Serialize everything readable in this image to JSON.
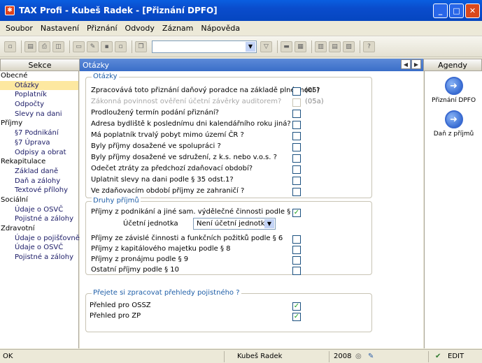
{
  "titlebar": {
    "app_name": "TAX Profi - Kubeš Radek - [Přiznání DPFO]"
  },
  "menu": [
    "Soubor",
    "Nastavení",
    "Přiznání",
    "Odvody",
    "Záznam",
    "Nápověda"
  ],
  "panels": {
    "left_header": "Sekce",
    "center_header": "Otázky",
    "right_header": "Agendy"
  },
  "tree": [
    {
      "label": "Obecné",
      "level": 0
    },
    {
      "label": "Otázky",
      "level": 1,
      "selected": true
    },
    {
      "label": "Poplatník",
      "level": 1
    },
    {
      "label": "Odpočty",
      "level": 1
    },
    {
      "label": "Slevy na dani",
      "level": 1
    },
    {
      "label": "Příjmy",
      "level": 0
    },
    {
      "label": "§7 Podnikání",
      "level": 1
    },
    {
      "label": "§7 Úprava",
      "level": 1
    },
    {
      "label": "Odpisy a obrat",
      "level": 1
    },
    {
      "label": "Rekapitulace",
      "level": 0
    },
    {
      "label": "Základ daně",
      "level": 1
    },
    {
      "label": "Daň a zálohy",
      "level": 1
    },
    {
      "label": "Textové přílohy",
      "level": 1
    },
    {
      "label": "Sociální",
      "level": 0
    },
    {
      "label": "Údaje o OSVČ",
      "level": 1
    },
    {
      "label": "Pojistné a zálohy",
      "level": 1
    },
    {
      "label": "Zdravotní",
      "level": 0
    },
    {
      "label": "Údaje o pojišťovně",
      "level": 1
    },
    {
      "label": "Údaje o OSVČ",
      "level": 1
    },
    {
      "label": "Pojistné a zálohy",
      "level": 1
    }
  ],
  "groups": {
    "otazky": "Otázky",
    "druhy": "Druhy příjmů",
    "prehledy": "Přejete si zpracovat přehledy pojistného ?"
  },
  "questions": [
    {
      "text": "Zpracovává toto přiznání daňový poradce na základě plné moci ?",
      "checked": false,
      "code": "(05)"
    },
    {
      "text": "Zákonná povinnost ověření účetní závěrky auditorem?",
      "checked": false,
      "code": "(05a)",
      "disabled": true
    },
    {
      "text": "Prodloužený termín podání přiznání?",
      "checked": false
    },
    {
      "text": "Adresa bydliště k poslednímu dni kalendářního roku jiná?",
      "checked": false
    },
    {
      "text": "Má poplatník trvalý pobyt mimo území ČR ?",
      "checked": false
    },
    {
      "text": "Byly příjmy dosažené ve spolupráci ?",
      "checked": false
    },
    {
      "text": "Byly příjmy dosažené ve sdružení, z k.s. nebo v.o.s. ?",
      "checked": false
    },
    {
      "text": "Odečet ztráty za předchozí zdaňovací období?",
      "checked": false
    },
    {
      "text": "Uplatnit slevy na dani podle § 35 odst.1?",
      "checked": false
    },
    {
      "text": "Ve zdaňovacím období příjmy ze zahraničí ?",
      "checked": false
    }
  ],
  "income": [
    {
      "text": "Příjmy z podnikání a jiné sam. výdělečné činnosti podle § 7",
      "checked": true
    },
    {
      "text": "Příjmy ze závislé činnosti a funkčních požitků podle § 6",
      "checked": false
    },
    {
      "text": "Příjmy z kapitálového majetku podle § 8",
      "checked": false
    },
    {
      "text": "Příjmy z pronájmu podle § 9",
      "checked": false
    },
    {
      "text": "Ostatní příjmy podle § 10",
      "checked": false
    }
  ],
  "ucetni": {
    "label": "Účetní jednotka",
    "value": "Není účetní jednotka"
  },
  "prehledy": [
    {
      "text": "Přehled pro OSSZ",
      "checked": true
    },
    {
      "text": "Přehled pro ZP",
      "checked": true
    }
  ],
  "agendas": [
    {
      "label": "Přiznání DPFO"
    },
    {
      "label": "Daň z příjmů"
    }
  ],
  "status": {
    "left": "OK",
    "user": "Kubeš Radek",
    "year": "2008",
    "mode": "EDIT"
  }
}
